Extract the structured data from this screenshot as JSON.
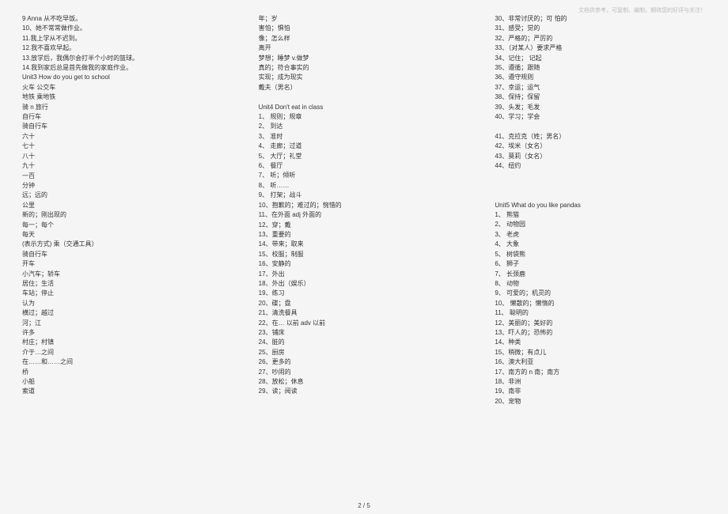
{
  "header_note": "文档供参考，可复制、编制，期待您的好评与关注！",
  "footer": "2 / 5",
  "col1": [
    "9 Anna  从不吃早饭。",
    "10、她不常常做作业。",
    "11.我上学从不迟到。",
    "12.我不喜欢早起。",
    "13.放学后，我偶尔会打半个小时的篮球。",
    "14.我到家后总是首先做我的家庭作业。",
    "Unit3    How do you get to school",
    "火车                               公交车",
    "地铁                                  乘地铁",
    "骑  n 旅行",
    "自行车",
    " 骑自行车",
    "六十",
    "七十",
    "八十",
    "九十",
    "一百",
    "分钟",
    "远；远的",
    "公里",
    "新的；刚出现的",
    "每一；每个",
    " 每天",
    "(表示方式) 乘（交通工具）",
    "骑自行车",
    "开车",
    "小汽车；轿车",
    "居住；生活",
    "车站；停止",
    "认为",
    "横过；越过",
    "河；江",
    "许多",
    "村庄；村镇",
    "介于…之间",
    "在……和……之间",
    "桥",
    "小船",
    "索道"
  ],
  "col2": [
    "年；岁",
    "害怕；惧怕",
    "像；怎么样",
    "离开",
    "梦想；睡梦    v.做梦",
    "真的；符合事实的",
    "实现；成为现实",
    "戴夫（男名）",
    "",
    "Unit4    Don't eat in class",
    "1、 规则；规章",
    "2、 到达",
    "3、 准时",
    "4、 走廊；过道",
    "5、 大厅；礼堂",
    "6、 餐厅",
    "7、 听；倾听",
    "8、 听……",
    "9、 打架；战斗",
    "10、抱歉的；难过的；惋惜的",
    "11、在外面 adj  外面的",
    "12、穿；戴",
    "13、重要的",
    "14、带来；取来",
    "15、校服；制服",
    "16、安静的",
    "17、外出",
    "18、外出（娱乐）",
    "19、练习",
    "20、碟；盘",
    "21、清洗餐具",
    "22、在… 以前 adv 以前",
    "23、铺床",
    "24、脏的",
    "25、厨房",
    "26、更多的",
    "27、吵闹的",
    "28、放松；休息",
    "29、读；阅读"
  ],
  "col3": [
    "30、非常讨厌的；可 怕的",
    "31、感受；觉的",
    "32、严格的；严厉的",
    "33、（对某人）要求严格",
    "34、记住；  记起",
    "35、遵循；跟随",
    "36、遵守规则",
    "37、幸运；运气",
    "38、保持；保留",
    "39、头发；毛发",
    "40、学习；学会",
    "",
    "41、克拉克（姓；男名）",
    "42、埃米（女名）",
    "43、莫莉（女名）",
    "44、纽约",
    "",
    "",
    "",
    "Unit5    What do you like pandas",
    "1、 熊猫",
    "2、 动物园",
    "3、 老虎",
    "4、 大象",
    "5、 树袋熊",
    "6、 狮子",
    "7、 长颈鹿",
    "8、 动物",
    "9、 可爱的；机灵的",
    "10、 懒散的；懒惰的",
    "11、  聪明的",
    "12、美丽的；美好的",
    "13、吓人的；恐怖的",
    "14、种类",
    "15、稍微；有点儿",
    "16、澳大利亚",
    "17、南方的 n  南；南方",
    "18、非洲",
    "19、南非",
    "20、宠物"
  ]
}
